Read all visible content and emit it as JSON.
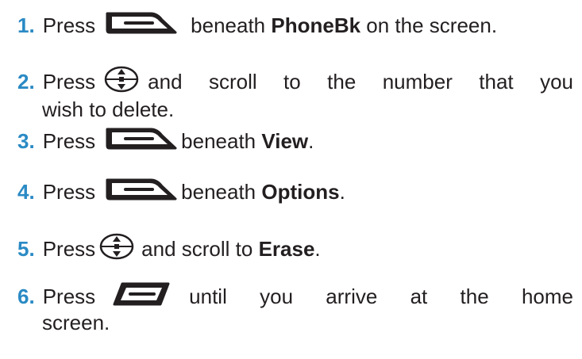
{
  "steps": [
    {
      "number": "1.",
      "press": "Press",
      "icon": "softkey-left-icon",
      "text_before": "beneath ",
      "bold": "PhoneBk",
      "text_after": " on the screen."
    },
    {
      "number": "2.",
      "press": "Press",
      "icon": "navigation-key-icon",
      "text_before": "and scroll to the number that you",
      "continuation": "wish to delete."
    },
    {
      "number": "3.",
      "press": "Press",
      "icon": "softkey-left-icon",
      "text_before": "beneath ",
      "bold": "View",
      "text_after": "."
    },
    {
      "number": "4.",
      "press": "Press",
      "icon": "softkey-left-icon",
      "text_before": "beneath ",
      "bold": "Options",
      "text_after": "."
    },
    {
      "number": "5.",
      "press": "Press",
      "icon": "navigation-key-icon",
      "text_before": "and scroll to ",
      "bold": "Erase",
      "text_after": "."
    },
    {
      "number": "6.",
      "press": "Press",
      "icon": "end-key-icon",
      "text_before": "until you arrive at the home",
      "continuation": "screen."
    }
  ]
}
